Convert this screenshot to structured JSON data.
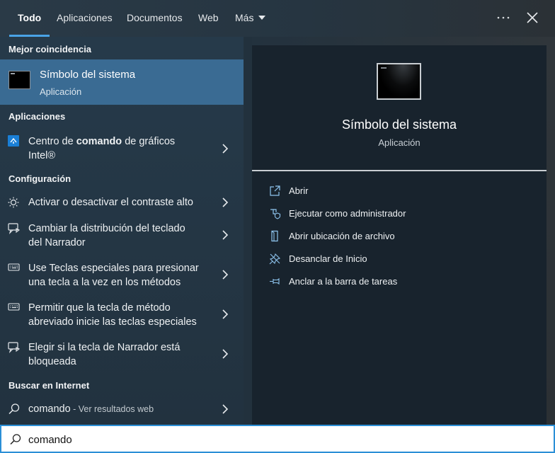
{
  "tabs": [
    {
      "label": "Todo"
    },
    {
      "label": "Aplicaciones"
    },
    {
      "label": "Documentos"
    },
    {
      "label": "Web"
    },
    {
      "label": "Más"
    }
  ],
  "window": {
    "more_icon": "ellipsis-icon",
    "close_icon": "close-icon"
  },
  "left": {
    "best_match_heading": "Mejor coincidencia",
    "best_match": {
      "title": "Símbolo del sistema",
      "subtitle": "Aplicación",
      "icon": "terminal-icon"
    },
    "apps_heading": "Aplicaciones",
    "apps": [
      {
        "pre": "Centro de ",
        "bold": "comando",
        "post": " de gráficos",
        "line2": "Intel®",
        "icon": "intel-graphics-icon"
      }
    ],
    "settings_heading": "Configuración",
    "settings": [
      {
        "line1": "Activar o desactivar el contraste alto",
        "line2": "",
        "icon": "brightness-icon"
      },
      {
        "line1": "Cambiar la distribución del teclado",
        "line2": "del Narrador",
        "icon": "narrator-icon"
      },
      {
        "line1": "Use Teclas especiales para presionar",
        "line2": "una tecla a la vez en los métodos",
        "icon": "keyboard-icon"
      },
      {
        "line1": "Permitir que la tecla de método",
        "line2": "abreviado inicie las teclas especiales",
        "icon": "keyboard-icon"
      },
      {
        "line1": "Elegir si la tecla de Narrador está",
        "line2": "bloqueada",
        "icon": "narrator-icon"
      }
    ],
    "web_heading": "Buscar en Internet",
    "web": {
      "query": "comando",
      "suffix": " - Ver resultados web",
      "icon": "search-icon"
    }
  },
  "preview": {
    "title": "Símbolo del sistema",
    "subtitle": "Aplicación",
    "actions": [
      {
        "label": "Abrir",
        "icon": "open-icon"
      },
      {
        "label": "Ejecutar como administrador",
        "icon": "shield-icon"
      },
      {
        "label": "Abrir ubicación de archivo",
        "icon": "file-location-icon"
      },
      {
        "label": "Desanclar de Inicio",
        "icon": "unpin-icon"
      },
      {
        "label": "Anclar a la barra de tareas",
        "icon": "pin-taskbar-icon"
      }
    ]
  },
  "search": {
    "value": "comando",
    "icon": "search-icon"
  },
  "colors": {
    "accent": "#4aa3e6",
    "selection": "#3a6b93",
    "search_border": "#2b8fd6"
  }
}
